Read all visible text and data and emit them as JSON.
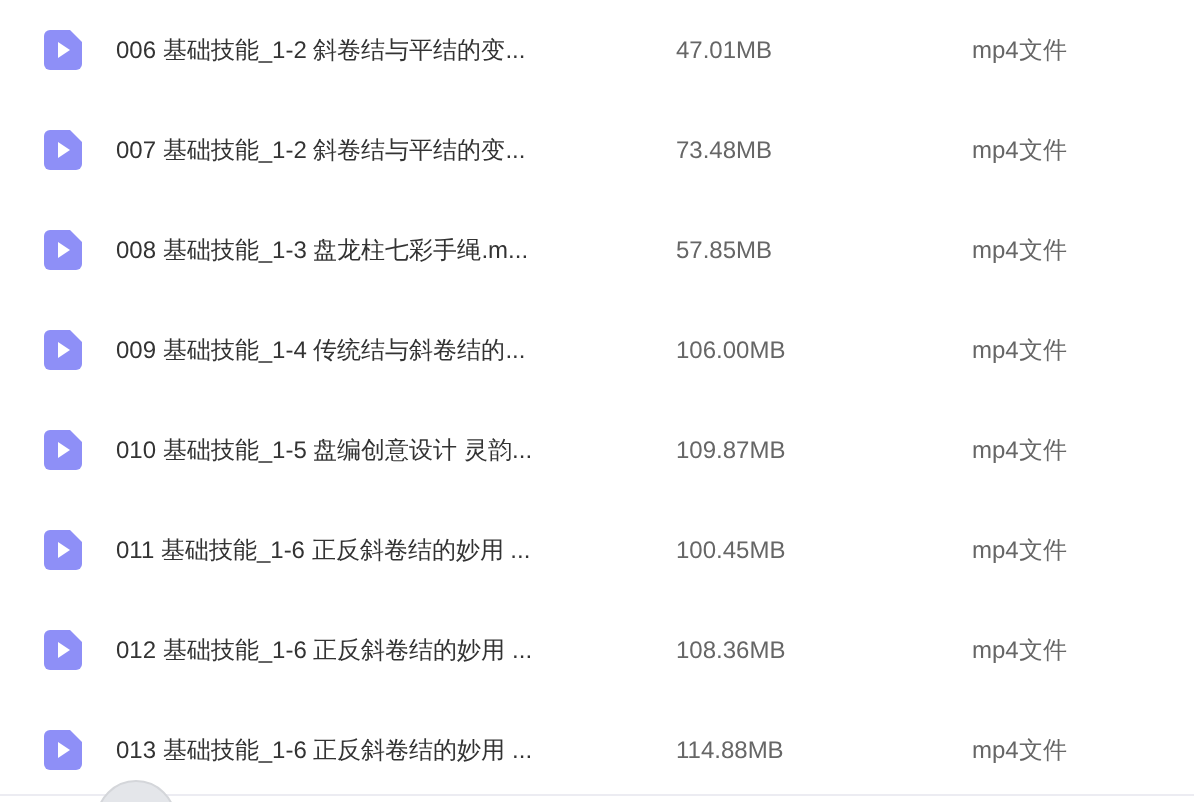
{
  "files": [
    {
      "name": "006 基础技能_1-2 斜卷结与平结的变...",
      "size": "47.01MB",
      "type": "mp4文件"
    },
    {
      "name": "007 基础技能_1-2 斜卷结与平结的变...",
      "size": "73.48MB",
      "type": "mp4文件"
    },
    {
      "name": "008 基础技能_1-3 盘龙柱七彩手绳.m...",
      "size": "57.85MB",
      "type": "mp4文件"
    },
    {
      "name": "009 基础技能_1-4 传统结与斜卷结的...",
      "size": "106.00MB",
      "type": "mp4文件"
    },
    {
      "name": "010 基础技能_1-5 盘编创意设计 灵韵...",
      "size": "109.87MB",
      "type": "mp4文件"
    },
    {
      "name": "011 基础技能_1-6 正反斜卷结的妙用 ...",
      "size": "100.45MB",
      "type": "mp4文件"
    },
    {
      "name": "012 基础技能_1-6 正反斜卷结的妙用 ...",
      "size": "108.36MB",
      "type": "mp4文件"
    },
    {
      "name": "013 基础技能_1-6 正反斜卷结的妙用 ...",
      "size": "114.88MB",
      "type": "mp4文件"
    }
  ]
}
